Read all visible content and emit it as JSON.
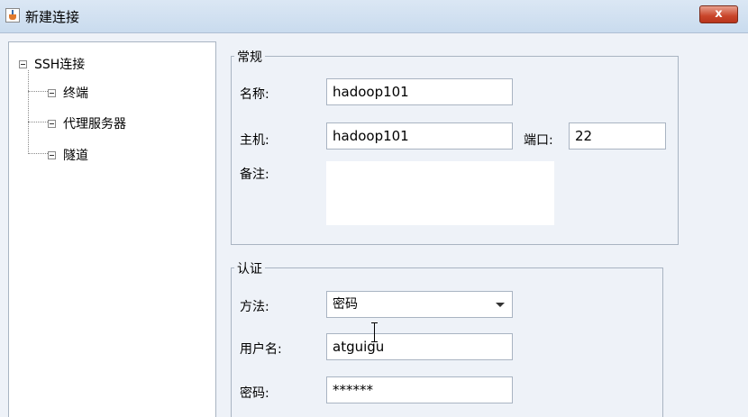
{
  "window": {
    "title": "新建连接",
    "close_symbol": "x",
    "app_icon": "java-coffee-icon"
  },
  "tree": {
    "root": "SSH连接",
    "items": [
      {
        "label": "终端"
      },
      {
        "label": "代理服务器"
      },
      {
        "label": "隧道"
      }
    ]
  },
  "general": {
    "legend": "常规",
    "name_label": "名称:",
    "name_value": "hadoop101",
    "host_label": "主机:",
    "host_value": "hadoop101",
    "port_label": "端口:",
    "port_value": "22",
    "notes_label": "备注:",
    "notes_value": ""
  },
  "auth": {
    "legend": "认证",
    "method_label": "方法:",
    "method_value": "密码",
    "username_label": "用户名:",
    "username_value": "atguigu",
    "password_label": "密码:",
    "password_value": "******"
  }
}
